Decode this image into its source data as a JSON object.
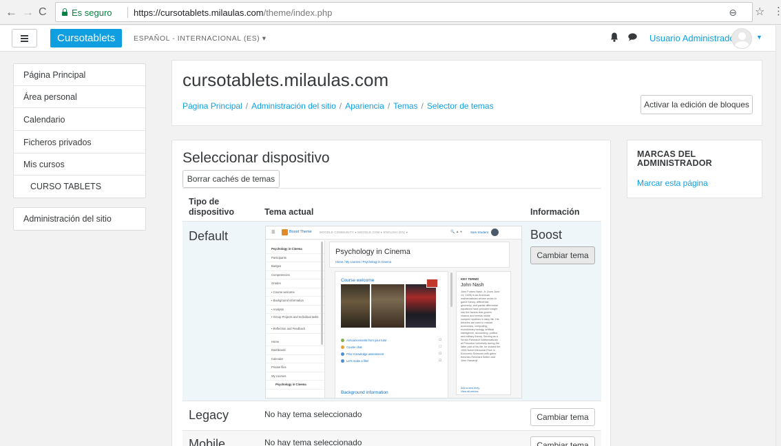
{
  "browser": {
    "secure_label": "Es seguro",
    "url_origin": "https://cursotablets.milaulas.com",
    "url_path": "/theme/index.php",
    "icons": [
      "back-arrow-icon",
      "forward-arrow-icon",
      "reload-icon",
      "lock-icon",
      "zoom-icon",
      "star-icon",
      "menu-dots-icon"
    ]
  },
  "navbar": {
    "brand": "Cursotablets",
    "language": "ESPAÑOL - INTERNACIONAL (ES) ▾",
    "user_name": "Usuario Administrador",
    "accent_color": "#0f9fe0"
  },
  "drawer": {
    "items": [
      {
        "label": "Página Principal"
      },
      {
        "label": "Área personal"
      },
      {
        "label": "Calendario"
      },
      {
        "label": "Ficheros privados"
      },
      {
        "label": "Mis cursos"
      },
      {
        "label": "CURSO TABLETS"
      }
    ],
    "admin_label": "Administración del sitio"
  },
  "header": {
    "site_title": "cursotablets.milaulas.com",
    "breadcrumb": [
      "Página Principal",
      "Administración del sitio",
      "Apariencia",
      "Temas",
      "Selector de temas"
    ],
    "edit_button": "Activar la edición de bloques"
  },
  "main": {
    "heading": "Seleccionar dispositivo",
    "purge_button": "Borrar cachés de temas",
    "columns": {
      "device_type": "Tipo de dispositivo",
      "current_theme": "Tema actual",
      "info": "Información"
    },
    "rows": [
      {
        "device": "Default",
        "theme_name": "Boost",
        "change_button": "Cambiar tema"
      },
      {
        "device": "Legacy",
        "no_theme": "No hay tema seleccionado",
        "change_button": "Cambiar tema"
      },
      {
        "device": "Mobile",
        "no_theme": "No hay tema seleccionado",
        "change_button": "Cambiar tema"
      }
    ]
  },
  "preview": {
    "brand": "Boost Theme",
    "menu": "MOODLE COMMUNITY ▾   MOODLE.COM ▾   ENGLISH (EN) ▾",
    "user": "Sam Student",
    "sidebar": [
      "Psychology in Cinema",
      "Participants",
      "Badges",
      "Competencies",
      "Grades",
      "Course welcome",
      "Background information",
      "Analysis",
      "Group Projects and Individual tasks",
      "Reflection and Feedback",
      "Home",
      "Dashboard",
      "Calendar",
      "Private files",
      "My courses",
      "Psychology in Cinema"
    ],
    "title": "Psychology in Cinema",
    "crumb": "Home / My courses / Psychology in Cinema",
    "welcome": "Course welcome",
    "activities": [
      "Announcements from your tutor",
      "Course chat",
      "Prior Knowledge assessment",
      "Let's make a film!"
    ],
    "bg_info": "Background information",
    "key_terms": "KEY TERMS",
    "person": "John Nash",
    "bio_lines": [
      "John Forbes Nash, Jr. (born June",
      "13, 1928) is an American",
      "mathematician whose works in",
      "game theory, differential",
      "geometry, and partial differential",
      "equations have provided insight",
      "into the factors that govern",
      "chance and events inside",
      "complex systems in daily life. His",
      "theories are used in market",
      "economics, computing,",
      "evolutionary biology, artificial",
      "intelligence, accounting, politics",
      "and military theory. Serving as a",
      "Senior Research Mathematician",
      "at Princeton University during the",
      "latter part of his life, he shared the",
      "1994 Nobel Memorial Prize in",
      "Economic Sciences with game",
      "theorists Reinhard Selten and",
      "John Harsanyi."
    ],
    "kt_links": [
      "Add a new entry",
      "View all entries"
    ]
  },
  "block": {
    "title": "MARCAS DEL ADMINISTRADOR",
    "link": "Marcar esta página"
  }
}
